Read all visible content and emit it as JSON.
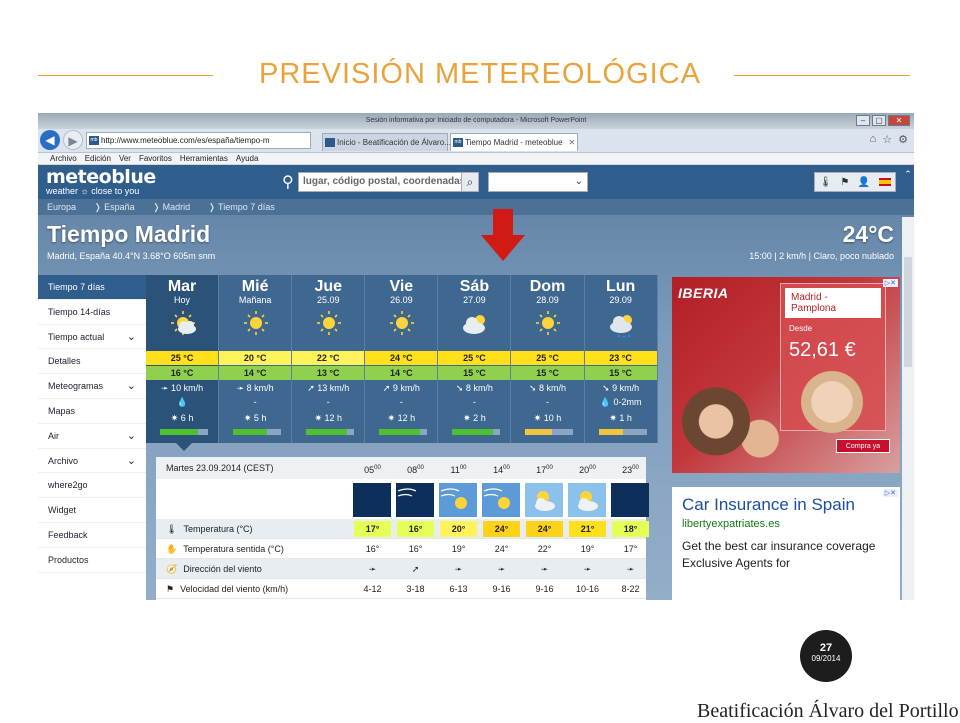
{
  "slide": {
    "title": "PREVISIÓN METEREOLÓGICA",
    "page_number": "27",
    "page_date": "09/2014",
    "footer": "Beatificación Álvaro del Portillo",
    "accent_color": "#e8a33a"
  },
  "browser": {
    "window_title": "Sesión informativa por Iniciado de computadora - Microsoft PowerPoint",
    "address": "http://www.meteoblue.com/es/españa/tiempo-m",
    "tabs": [
      {
        "label": "Inicio - Beatificación de Álvaro...",
        "active": false
      },
      {
        "label": "Tiempo Madrid - meteoblue",
        "active": true
      }
    ],
    "menu": [
      "Archivo",
      "Edición",
      "Ver",
      "Favoritos",
      "Herramientas",
      "Ayuda"
    ]
  },
  "site": {
    "logo": "meteoblue",
    "tagline": "weather ☼ close to you",
    "search_placeholder": "lugar, código postal, coordenadas",
    "breadcrumbs": [
      "Europa",
      "❭ España",
      "❭ Madrid",
      "❭ Tiempo 7 días"
    ],
    "city_title": "Tiempo Madrid",
    "city_info": "Madrid, España 40.4°N 3.68°O 605m snm",
    "current_temp": "24°C",
    "current_info": "15:00 | 2 km/h | Claro, poco nublado"
  },
  "sidebar": [
    {
      "label": "Tiempo 7 días",
      "active": true,
      "chevron": false
    },
    {
      "label": "Tiempo 14-días",
      "active": false,
      "chevron": false
    },
    {
      "label": "Tiempo actual",
      "active": false,
      "chevron": true
    },
    {
      "label": "Detalles",
      "active": false,
      "chevron": false
    },
    {
      "label": "Meteogramas",
      "active": false,
      "chevron": true
    },
    {
      "label": "Mapas",
      "active": false,
      "chevron": false
    },
    {
      "label": "Air",
      "active": false,
      "chevron": true
    },
    {
      "label": "Archivo",
      "active": false,
      "chevron": true
    },
    {
      "label": "where2go",
      "active": false,
      "chevron": false
    },
    {
      "label": "Widget",
      "active": false,
      "chevron": false
    },
    {
      "label": "Feedback",
      "active": false,
      "chevron": false
    },
    {
      "label": "Productos",
      "active": false,
      "chevron": false
    }
  ],
  "days": [
    {
      "name": "Mar",
      "date": "Hoy",
      "icon": "sun-cloud",
      "max": "25 °C",
      "min": "16 °C",
      "wind": "➛ 10 km/h",
      "prec": "💧",
      "sun": "✷ 6 h",
      "bar": 0.8,
      "max_color": "#ffe01a",
      "min_color": "#8fd14f"
    },
    {
      "name": "Mié",
      "date": "Mañana",
      "icon": "sun",
      "max": "20 °C",
      "min": "14 °C",
      "wind": "➛ 8 km/h",
      "prec": "-",
      "sun": "✷ 5 h",
      "bar": 0.7,
      "max_color": "#fff25a",
      "min_color": "#8fd14f"
    },
    {
      "name": "Jue",
      "date": "25.09",
      "icon": "sun",
      "max": "22 °C",
      "min": "13 °C",
      "wind": "➚ 13 km/h",
      "prec": "-",
      "sun": "✷ 12 h",
      "bar": 0.85,
      "max_color": "#fff25a",
      "min_color": "#8fd14f"
    },
    {
      "name": "Vie",
      "date": "26.09",
      "icon": "sun",
      "max": "24 °C",
      "min": "14 °C",
      "wind": "➚ 9 km/h",
      "prec": "-",
      "sun": "✷ 12 h",
      "bar": 0.85,
      "max_color": "#ffe01a",
      "min_color": "#8fd14f"
    },
    {
      "name": "Sáb",
      "date": "27.09",
      "icon": "cloud-sun",
      "max": "25 °C",
      "min": "15 °C",
      "wind": "➘ 8 km/h",
      "prec": "-",
      "sun": "✷ 2 h",
      "bar": 0.85,
      "max_color": "#ffe01a",
      "min_color": "#8fd14f"
    },
    {
      "name": "Dom",
      "date": "28.09",
      "icon": "sun",
      "max": "25 °C",
      "min": "15 °C",
      "wind": "➘ 8 km/h",
      "prec": "-",
      "sun": "✷ 10 h",
      "bar": 0.55,
      "max_color": "#ffe01a",
      "min_color": "#8fd14f"
    },
    {
      "name": "Lun",
      "date": "29.09",
      "icon": "rain-sun",
      "max": "23 °C",
      "min": "15 °C",
      "wind": "➘ 9 km/h",
      "prec": "💧 0-2mm",
      "sun": "✷ 1 h",
      "bar": 0.5,
      "max_color": "#ffe01a",
      "min_color": "#8fd14f"
    }
  ],
  "detail": {
    "header": "Martes 23.09.2014 (CEST)",
    "hours": [
      "05",
      "08",
      "11",
      "14",
      "17",
      "20",
      "23"
    ],
    "hour_icons": [
      "moon",
      "moon-wind",
      "sun-wind",
      "sun-wind",
      "sun-cloud",
      "sun-cloud",
      "moon"
    ],
    "rows": [
      {
        "icon": "🌡",
        "label": "Temperatura (°C)",
        "values": [
          "17°",
          "16°",
          "20°",
          "24°",
          "24°",
          "21°",
          "18°"
        ],
        "colors": [
          "#e5ff57",
          "#e5ff57",
          "#fff25a",
          "#ffd21a",
          "#ffd21a",
          "#ffe01a",
          "#e5ff57"
        ]
      },
      {
        "icon": "✋",
        "label": "Temperatura sentida (°C)",
        "values": [
          "16°",
          "16°",
          "19°",
          "24°",
          "22°",
          "19°",
          "17°"
        ]
      },
      {
        "icon": "🧭",
        "label": "Dirección del viento",
        "values": [
          "➛",
          "➚",
          "➛",
          "➛",
          "➛",
          "➛",
          "➛"
        ]
      },
      {
        "icon": "⚑",
        "label": "Velocidad del viento (km/h)",
        "values": [
          "4-12",
          "3-18",
          "6-13",
          "9-16",
          "9-16",
          "10-16",
          "8-22"
        ]
      }
    ]
  },
  "ads": {
    "iberia": {
      "brand": "IBERIA",
      "route": "Madrid - Pamplona",
      "from": "Desde",
      "price": "52,61 €",
      "cta": "Compra ya"
    },
    "insurance": {
      "title": "Car Insurance in Spain",
      "url": "libertyexpatriates.es",
      "desc": "Get the best car insurance coverage Exclusive Agents for"
    }
  }
}
